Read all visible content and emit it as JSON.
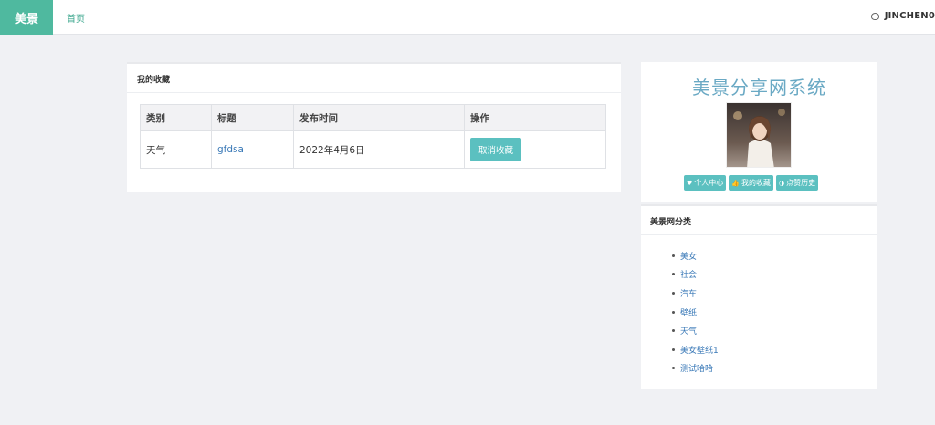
{
  "nav": {
    "brand": "美景",
    "home": "首页",
    "username": "JINCHEN0"
  },
  "favorites": {
    "heading": "我的收藏",
    "columns": [
      "类别",
      "标题",
      "发布时间",
      "操作"
    ],
    "rows": [
      {
        "category": "天气",
        "title": "gfdsa",
        "date": "2022年4月6日",
        "action": "取消收藏"
      }
    ]
  },
  "profile": {
    "site_title": "美景分享网系统",
    "buttons": [
      {
        "label": "个人中心",
        "icon": "heart-icon"
      },
      {
        "label": "我的收藏",
        "icon": "thumbs-up-icon"
      },
      {
        "label": "点赞历史",
        "icon": "half-circle-icon"
      }
    ]
  },
  "categories": {
    "heading": "美景网分类",
    "items": [
      "美女",
      "社会",
      "汽车",
      "壁纸",
      "天气",
      "美女壁纸1",
      "测试哈哈"
    ]
  },
  "colors": {
    "brand": "#4fb99f",
    "accent_button": "#5bc0c0",
    "link": "#3a79b7"
  }
}
